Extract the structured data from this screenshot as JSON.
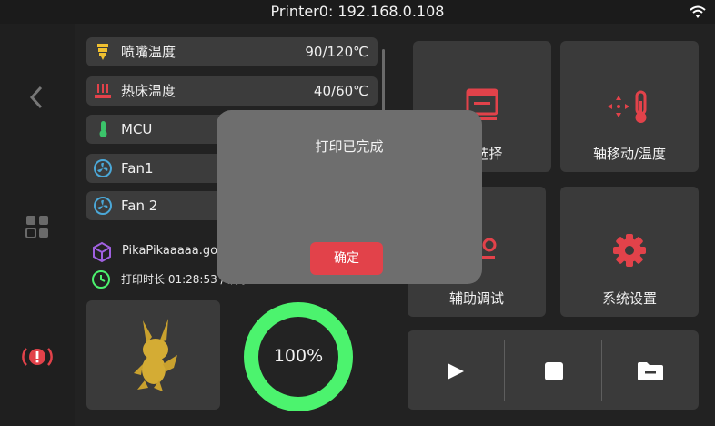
{
  "status_bar": {
    "title": "Printer0: 192.168.0.108"
  },
  "stats": [
    {
      "label": "喷嘴温度",
      "value": "90/120℃"
    },
    {
      "label": "热床温度",
      "value": "40/60℃"
    },
    {
      "label": "MCU",
      "value": ""
    },
    {
      "label": "Fan1",
      "value": ""
    },
    {
      "label": "Fan 2",
      "value": ""
    }
  ],
  "file": {
    "name": "PikaPikaaaaa.go",
    "time_text": "打印时长 01:28:53 / 剩余00:00:00"
  },
  "progress": {
    "text": "100%",
    "value": 1.0
  },
  "tiles": [
    {
      "label": "机选择"
    },
    {
      "label": "轴移动/温度"
    },
    {
      "label": "辅助调试"
    },
    {
      "label": "系统设置"
    }
  ],
  "dialog": {
    "message": "打印已完成",
    "ok_label": "确定"
  },
  "colors": {
    "accent": "#e2424a",
    "progress": "#4cf36e",
    "fan": "#4ba8d8",
    "mcu": "#3bc46a",
    "file": "#a060e0"
  }
}
